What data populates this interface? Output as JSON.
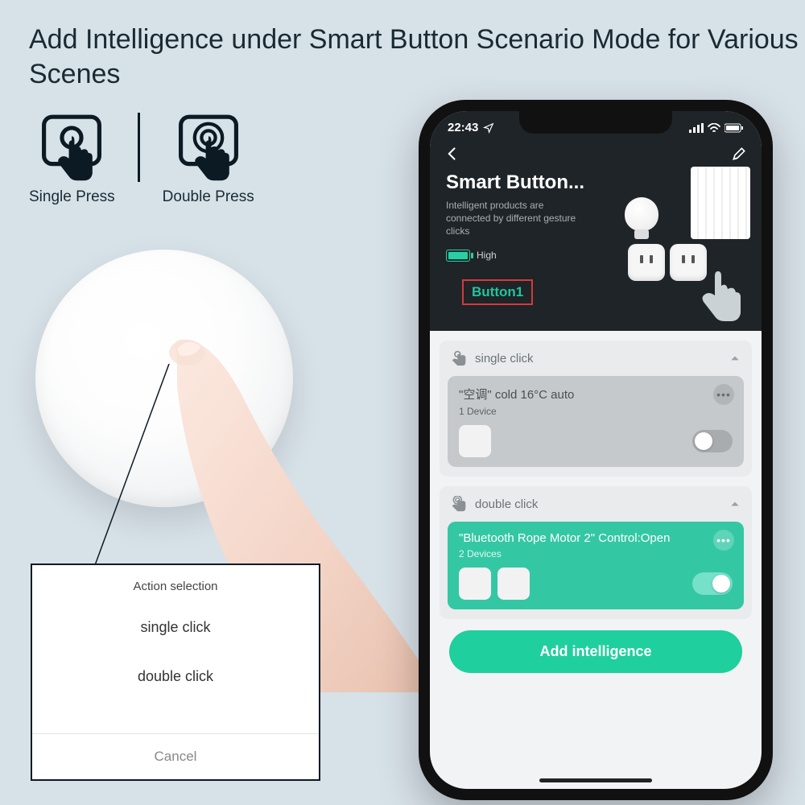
{
  "heading": "Add Intelligence under Smart Button Scenario Mode for Various Scenes",
  "press": {
    "single": "Single Press",
    "double": "Double Press"
  },
  "popup": {
    "title": "Action selection",
    "opt1": "single click",
    "opt2": "double click",
    "cancel": "Cancel"
  },
  "phone": {
    "time": "22:43",
    "title": "Smart Button...",
    "subtitle": "Intelligent products are connected by different gesture clicks",
    "battery": "High",
    "tab": "Button1",
    "sections": {
      "single": {
        "label": "single click",
        "card_title": "\"空调\" cold 16°C auto",
        "card_sub": "1 Device"
      },
      "double": {
        "label": "double click",
        "card_title": "\"Bluetooth Rope Motor 2\" Control:Open",
        "card_sub": "2 Devices"
      }
    },
    "add": "Add intelligence"
  }
}
